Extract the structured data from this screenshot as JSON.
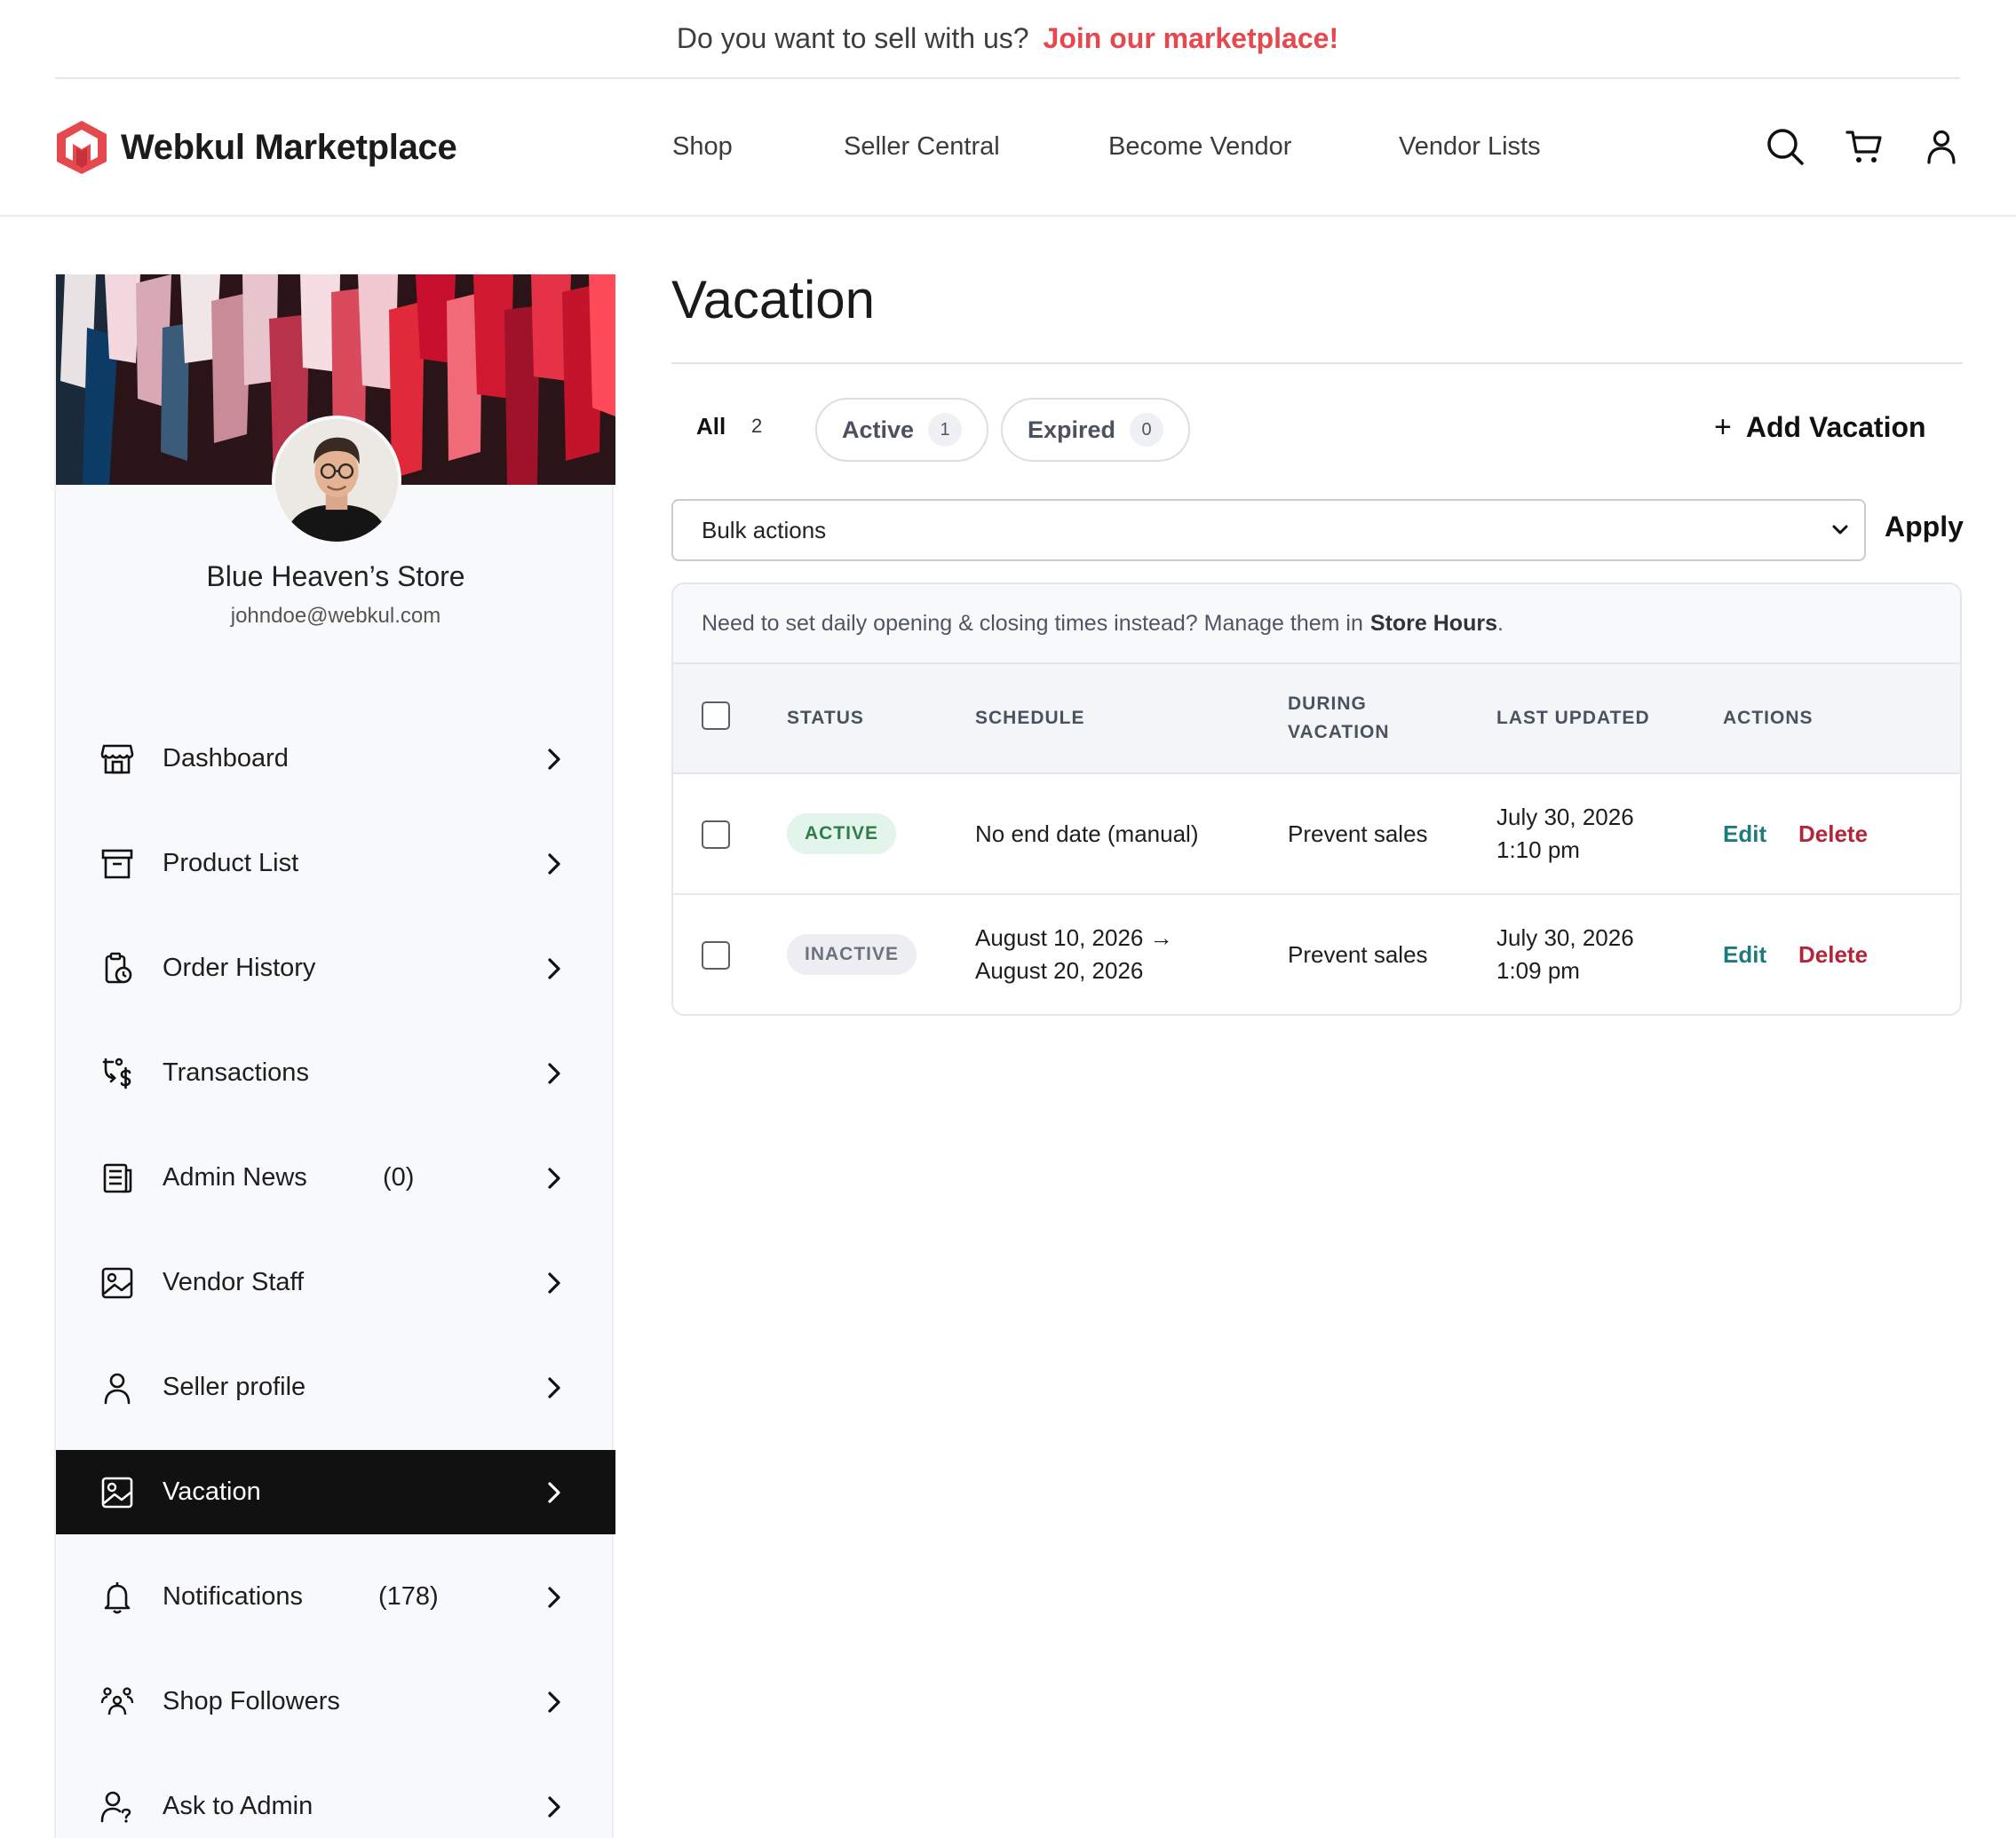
{
  "promo": {
    "text": "Do you want to sell with us?",
    "link": "Join our marketplace!"
  },
  "header": {
    "brand": "Webkul Marketplace",
    "nav": [
      "Shop",
      "Seller Central",
      "Become Vendor",
      "Vendor Lists"
    ],
    "icons": [
      "search-icon",
      "cart-icon",
      "user-icon"
    ]
  },
  "sidebar": {
    "store_name": "Blue Heaven’s Store",
    "email": "johndoe@webkul.com",
    "items": [
      {
        "label": "Dashboard",
        "count": "",
        "icon": "store-icon"
      },
      {
        "label": "Product List",
        "count": "",
        "icon": "archive-icon"
      },
      {
        "label": "Order History",
        "count": "",
        "icon": "order-history-icon"
      },
      {
        "label": "Transactions",
        "count": "",
        "icon": "transactions-icon"
      },
      {
        "label": "Admin News",
        "count": "(0)",
        "icon": "news-icon"
      },
      {
        "label": "Vendor Staff",
        "count": "",
        "icon": "image-icon"
      },
      {
        "label": "Seller profile",
        "count": "",
        "icon": "user-icon"
      },
      {
        "label": "Vacation",
        "count": "",
        "icon": "image-icon",
        "active": true
      },
      {
        "label": "Notifications",
        "count": "(178)",
        "icon": "bell-icon"
      },
      {
        "label": "Shop Followers",
        "count": "",
        "icon": "followers-icon"
      },
      {
        "label": "Ask to Admin",
        "count": "",
        "icon": "ask-admin-icon"
      }
    ]
  },
  "main": {
    "title": "Vacation",
    "tabs": {
      "all": {
        "label": "All",
        "count": "2"
      },
      "active": {
        "label": "Active",
        "count": "1"
      },
      "expired": {
        "label": "Expired",
        "count": "0"
      }
    },
    "add_button": "Add Vacation",
    "bulk_select": "Bulk actions",
    "apply": "Apply",
    "notice": {
      "text": "Need to set daily opening & closing times instead? Manage them in",
      "link": "Store Hours",
      "end": "."
    },
    "columns": {
      "status": "STATUS",
      "schedule": "SCHEDULE",
      "during_1": "DURING",
      "during_2": "VACATION",
      "last_updated": "LAST UPDATED",
      "actions": "ACTIONS"
    },
    "rows": [
      {
        "status": "ACTIVE",
        "schedule_1": "No end date (manual)",
        "schedule_2": "",
        "during": "Prevent sales",
        "updated_1": "July 30, 2026",
        "updated_2": "1:10 pm",
        "edit": "Edit",
        "delete": "Delete"
      },
      {
        "status": "INACTIVE",
        "schedule_1": "August 10, 2026 →",
        "schedule_2": "August 20, 2026",
        "during": "Prevent sales",
        "updated_1": "July 30, 2026",
        "updated_2": "1:09 pm",
        "edit": "Edit",
        "delete": "Delete"
      }
    ]
  },
  "colors": {
    "accent": "#e5484d",
    "edit": "#1e7a7f",
    "delete": "#b3263a",
    "active_menu": "#111111"
  }
}
